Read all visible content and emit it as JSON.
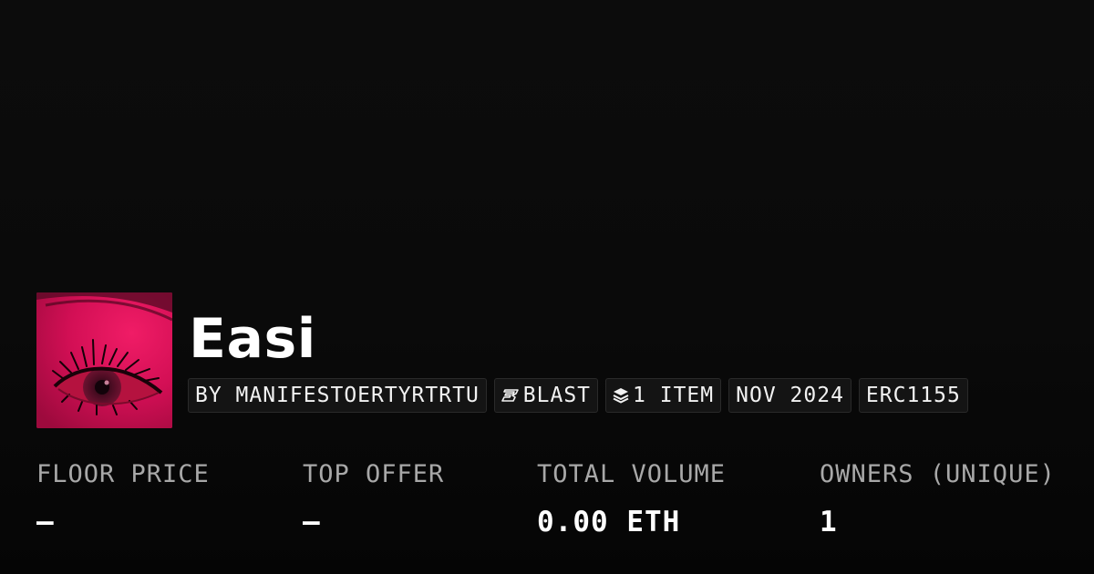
{
  "collection": {
    "name": "Easi",
    "avatar_icon": "collection-artwork-eye-image"
  },
  "chips": {
    "creator": "BY MANIFESTOERTYRTRTU",
    "chain": "BLAST",
    "chain_icon": "blast-logo-icon",
    "items": "1 ITEM",
    "items_icon": "layers-icon",
    "date": "NOV 2024",
    "standard": "ERC1155"
  },
  "stats": {
    "floor_price": {
      "label": "FLOOR PRICE",
      "value": "–"
    },
    "top_offer": {
      "label": "TOP OFFER",
      "value": "–"
    },
    "total_volume": {
      "label": "TOTAL VOLUME",
      "value": "0.00 ETH"
    },
    "owners": {
      "label": "OWNERS (UNIQUE)",
      "value": "1"
    }
  },
  "colors": {
    "background": "#0a0a0a",
    "chip_background": "#141414",
    "chip_border": "#2a2a2a",
    "label_gray": "#a8a8a8",
    "text_white": "#ffffff",
    "avatar_magenta": "#d10f52"
  }
}
